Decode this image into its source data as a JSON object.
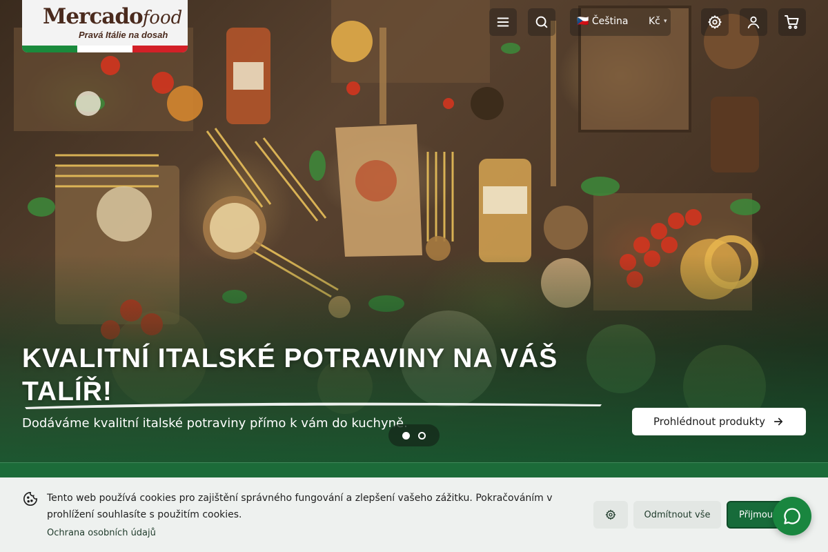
{
  "brand": {
    "name_main": "Mercado",
    "name_suffix": "food",
    "tagline": "Pravá Itálie na dosah",
    "flag_colors": [
      "#1a8a3c",
      "#ffffff",
      "#d32027"
    ]
  },
  "header": {
    "menu_icon": "hamburger-icon",
    "search_icon": "search-icon",
    "language_flag": "🇨🇿",
    "language_label": "Čeština",
    "currency_label": "Kč",
    "settings_icon": "gear-icon",
    "account_icon": "user-icon",
    "cart_icon": "cart-icon"
  },
  "hero": {
    "title": "KVALITNÍ ITALSKÉ POTRAVINY NA VÁŠ TALÍŘ!",
    "subtitle": "Dodáváme kvalitní italské potraviny přímo k vám do kuchyně.",
    "cta_label": "Prohlédnout produkty",
    "slides_total": 2,
    "slide_active": 1
  },
  "cookie_bar": {
    "text": "Tento web používá cookies pro zajištění správného fungování a zlepšení vašeho zážitku. Pokračováním v prohlížení souhlasíte s použitím cookies.",
    "privacy_link": "Ochrana osobních údajů",
    "reject_label": "Odmítnout vše",
    "accept_label": "Přijmout vše"
  },
  "colors": {
    "accent_green": "#176b3a",
    "chat_green": "#19863f",
    "brand_brown": "#4a2a1d"
  }
}
